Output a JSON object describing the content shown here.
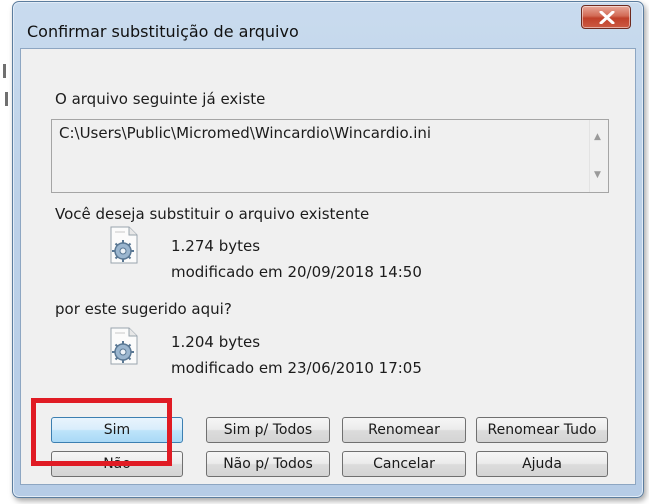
{
  "window": {
    "title": "Confirmar substituição de arquivo"
  },
  "dialog": {
    "intro": "O arquivo seguinte já existe",
    "path": "C:\\Users\\Public\\Micromed\\Wincardio\\Wincardio.ini",
    "question": "Você deseja substituir o arquivo existente",
    "existing": {
      "size": "1.274 bytes",
      "modified": "modificado em 20/09/2018 14:50"
    },
    "replacement_prompt": "por este sugerido aqui?",
    "suggested": {
      "size": "1.204 bytes",
      "modified": "modificado em 23/06/2010 17:05"
    }
  },
  "buttons": {
    "yes": "Sim",
    "yes_all": "Sim p/ Todos",
    "rename": "Renomear",
    "rename_all": "Renomear Tudo",
    "no": "Não",
    "no_all": "Não p/ Todos",
    "cancel": "Cancelar",
    "help": "Ajuda"
  },
  "colors": {
    "highlight": "#e01b24",
    "close_button": "#c0402a"
  }
}
